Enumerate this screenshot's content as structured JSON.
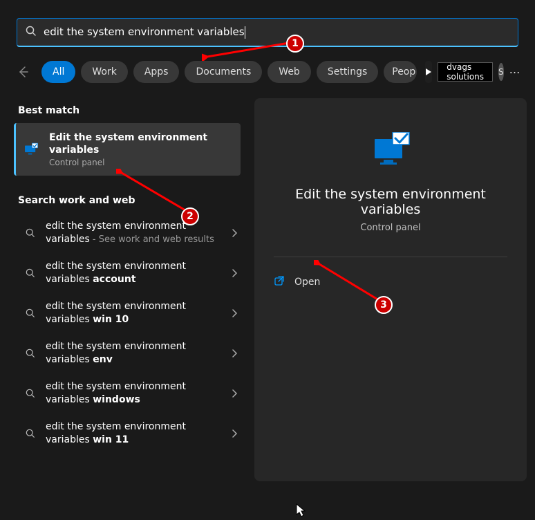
{
  "search": {
    "query": "edit the system environment variables"
  },
  "tabs": [
    {
      "label": "All",
      "active": true
    },
    {
      "label": "Work",
      "active": false
    },
    {
      "label": "Apps",
      "active": false
    },
    {
      "label": "Documents",
      "active": false
    },
    {
      "label": "Web",
      "active": false
    },
    {
      "label": "Settings",
      "active": false
    },
    {
      "label": "Peop",
      "active": false
    }
  ],
  "org_label": "dvags solutions",
  "avatar_letter": "S",
  "best_match_header": "Best match",
  "best_match": {
    "title": "Edit the system environment variables",
    "subtitle": "Control panel"
  },
  "search_web_header": "Search work and web",
  "suggestions": [
    {
      "prefix": "edit the system environment variables",
      "bold": "",
      "suffix": " - See work and web results"
    },
    {
      "prefix": "edit the system environment variables ",
      "bold": "account",
      "suffix": ""
    },
    {
      "prefix": "edit the system environment variables ",
      "bold": "win 10",
      "suffix": ""
    },
    {
      "prefix": "edit the system environment variables ",
      "bold": "env",
      "suffix": ""
    },
    {
      "prefix": "edit the system environment variables ",
      "bold": "windows",
      "suffix": ""
    },
    {
      "prefix": "edit the system environment variables ",
      "bold": "win 11",
      "suffix": ""
    }
  ],
  "preview": {
    "title": "Edit the system environment variables",
    "subtitle": "Control panel",
    "action": "Open"
  },
  "annotations": {
    "step1": "1",
    "step2": "2",
    "step3": "3"
  }
}
